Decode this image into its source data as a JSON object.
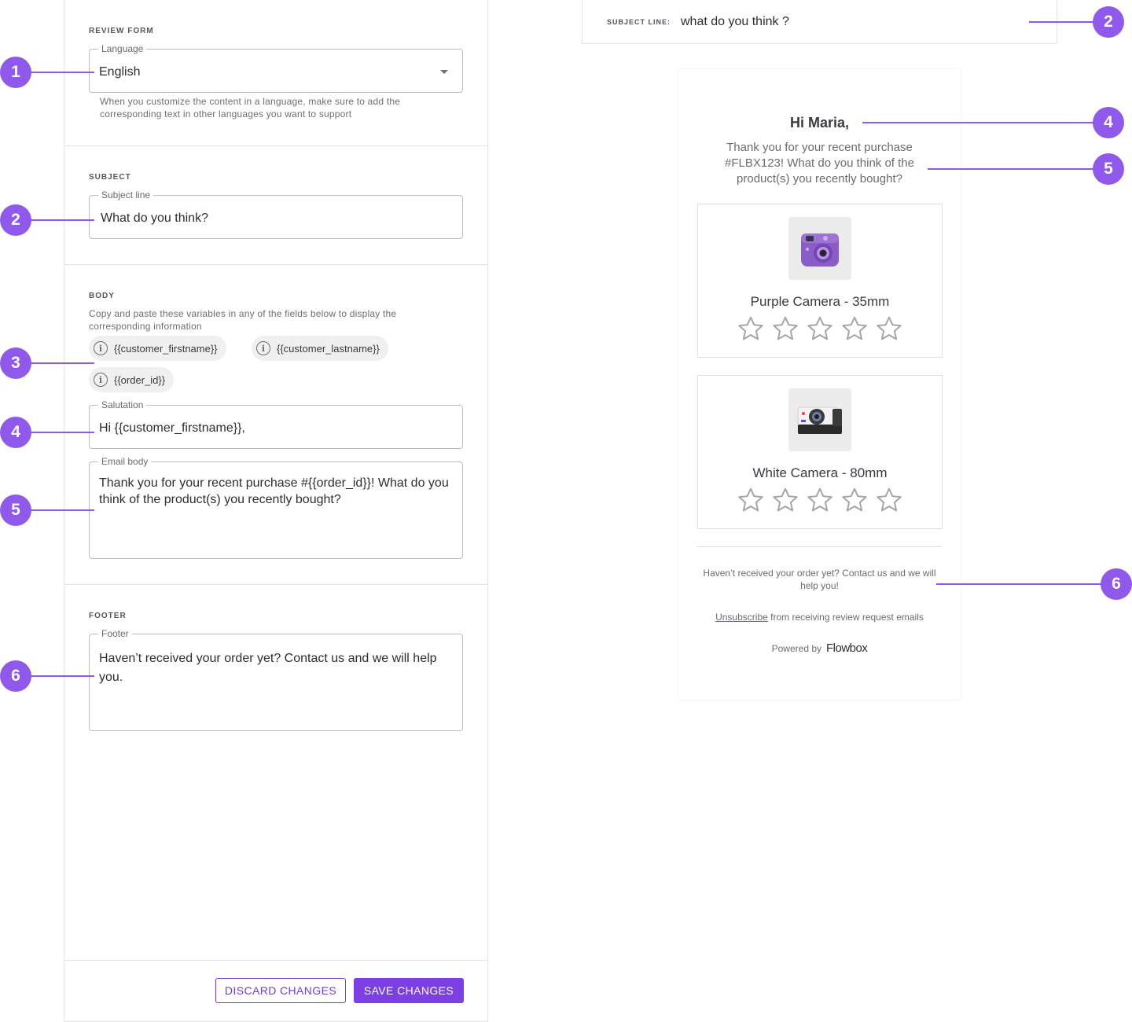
{
  "editor": {
    "review_form": {
      "title": "REVIEW FORM",
      "language_label": "Language",
      "language_value": "English",
      "helper": "When you customize the content in a language, make sure to add the corresponding text in other languages you want to support"
    },
    "subject": {
      "title": "SUBJECT",
      "label": "Subject line",
      "value": "What do you think?"
    },
    "body": {
      "title": "BODY",
      "description": "Copy and paste these variables in any of the fields below to display the corresponding information",
      "chips": [
        "{{customer_firstname}}",
        "{{customer_lastname}}",
        "{{order_id}}"
      ],
      "salutation_label": "Salutation",
      "salutation_value": "Hi {{customer_firstname}},",
      "email_body_label": "Email body",
      "email_body_value": "Thank you for your recent purchase #{{order_id}}! What do you think of the product(s) you recently bought?"
    },
    "footer": {
      "title": "FOOTER",
      "label": "Footer",
      "value": "Haven’t received your order yet? Contact us and we will help you."
    },
    "buttons": {
      "discard": "DISCARD CHANGES",
      "save": "SAVE CHANGES"
    }
  },
  "preview": {
    "subject_key": "SUBJECT LINE:",
    "subject_value": "what do you think ?",
    "greeting": "Hi Maria,",
    "intro": "Thank you for your recent purchase #FLBX123! What do you think of the product(s) you recently bought?",
    "products": [
      {
        "name": "Purple Camera - 35mm",
        "rating": 0,
        "max_rating": 5
      },
      {
        "name": "White Camera - 80mm",
        "rating": 0,
        "max_rating": 5
      }
    ],
    "footer_text": "Haven’t received your order yet? Contact us and we will help you!",
    "unsubscribe_link": "Unsubscribe",
    "unsubscribe_rest": "from receiving review request emails",
    "powered_by": "Powered by",
    "brand": "Flowbox"
  },
  "markers": {
    "left": [
      "1",
      "2",
      "3",
      "4",
      "5",
      "6"
    ],
    "right": [
      "2",
      "4",
      "5",
      "6"
    ]
  },
  "colors": {
    "accent": "#7b3fe4",
    "marker": "#8f59ec",
    "border": "#e3e3e3"
  }
}
